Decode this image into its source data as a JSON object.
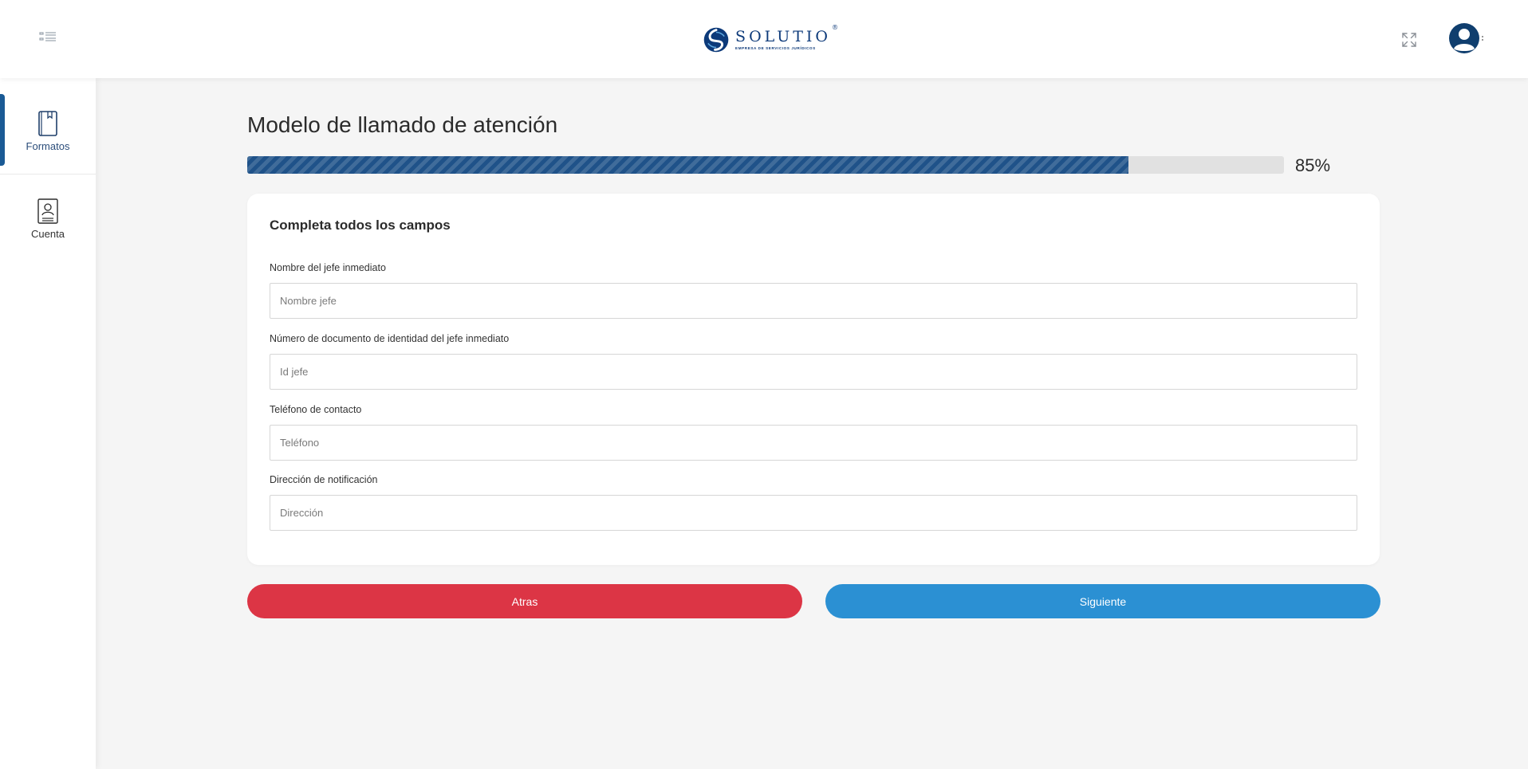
{
  "header": {
    "brand_name": "SOLUTIO",
    "brand_reg": "®",
    "brand_tagline": "EMPRESA DE SERVICIOS JURÍDICOS",
    "icons": [
      "menu-list-icon",
      "solutio-logo-icon",
      "fullscreen-expand-icon",
      "user-avatar-icon",
      "kebab-dots-icon"
    ]
  },
  "sidebar": {
    "items": [
      {
        "label": "Formatos",
        "icon": "book-icon",
        "active": true
      },
      {
        "label": "Cuenta",
        "icon": "account-badge-icon",
        "active": false
      }
    ]
  },
  "main": {
    "title": "Modelo de llamado de atención",
    "progress": {
      "value": 85,
      "label": "85%"
    },
    "card_heading": "Completa todos los campos",
    "fields": [
      {
        "label": "Nombre del jefe inmediato",
        "placeholder": "Nombre jefe",
        "value": ""
      },
      {
        "label": "Número de documento de identidad del jefe inmediato",
        "placeholder": "Id jefe",
        "value": ""
      },
      {
        "label": "Teléfono de contacto",
        "placeholder": "Teléfono",
        "value": ""
      },
      {
        "label": "Dirección de notificación",
        "placeholder": "Dirección",
        "value": ""
      }
    ],
    "buttons": {
      "back": "Atras",
      "next": "Siguiente"
    }
  },
  "colors": {
    "brand_blue": "#0d3a7a",
    "progress_blue": "#1f5289",
    "back_red": "#dc3545",
    "next_blue": "#2b90d3",
    "sidebar_active": "#1a5a95",
    "background": "#f5f5f5"
  }
}
